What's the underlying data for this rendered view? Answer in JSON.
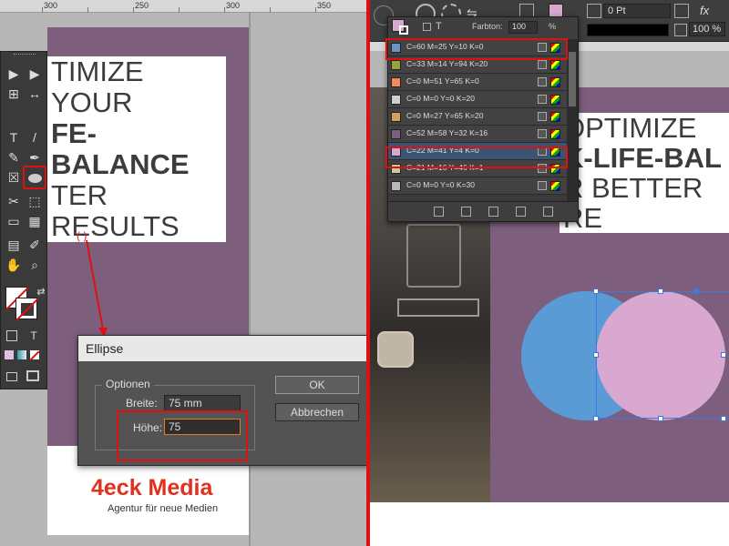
{
  "ruler_left": {
    "labels": [
      "300",
      "250",
      "300",
      "350"
    ]
  },
  "document_left": {
    "headline_lines": [
      "TIMIZE YOUR",
      "FE-BALANCE",
      "TER RESULTS"
    ],
    "logo_main": "4eck Media",
    "logo_sub": "Agentur für neue Medien",
    "annotation": "( )"
  },
  "tools": {
    "glyphs": [
      "▶",
      "▶",
      "↔",
      "⊞",
      "T",
      "/",
      "✎",
      "✒",
      "☒",
      "✂",
      "⬚",
      "▭",
      "▦",
      "✋",
      "⌕",
      "T"
    ]
  },
  "dialog": {
    "title": "Ellipse",
    "group_label": "Optionen",
    "width_label": "Breite:",
    "width_value": "75 mm",
    "height_label": "Höhe:",
    "height_value": "75",
    "ok_label": "OK",
    "cancel_label": "Abbrechen"
  },
  "control_bar": {
    "stroke_value": "0 Pt",
    "zoom_value": "100 %"
  },
  "swatches": {
    "tint_label": "Farbton:",
    "tint_value": "100",
    "tint_unit": "%",
    "items": [
      {
        "name": "C=60 M=25 Y=10 K=0",
        "color": "#6b95c4",
        "active": false
      },
      {
        "name": "C=33 M=14 Y=94 K=20",
        "color": "#9aa23a",
        "active": false
      },
      {
        "name": "C=0 M=51 Y=65 K=0",
        "color": "#f08a5a",
        "active": false
      },
      {
        "name": "C=0 M=0 Y=0 K=20",
        "color": "#cfcfcf",
        "active": false
      },
      {
        "name": "C=0 M=27 Y=65 K=20",
        "color": "#d2a25a",
        "active": false
      },
      {
        "name": "C=52 M=58 Y=32 K=16",
        "color": "#7d5f7d",
        "active": false
      },
      {
        "name": "C=22 M=41 Y=4 K=0",
        "color": "#d9a8d1",
        "active": true
      },
      {
        "name": "C=21 M=16 Y=46 K=1",
        "color": "#cdc79b",
        "active": false
      },
      {
        "name": "C=0 M=0 Y=0 K=30",
        "color": "#b8b8b8",
        "active": false
      }
    ]
  },
  "document_right": {
    "headline_lines": [
      "OPTIMIZE",
      "K-LIFE-BAL",
      "R BETTER RE"
    ]
  },
  "colors": {
    "highlight": "#e01010",
    "page_purple": "#7d5f7d",
    "circle_blue": "#5b9bd5",
    "circle_pink": "#d9a8d1",
    "logo_red": "#e0301e"
  }
}
